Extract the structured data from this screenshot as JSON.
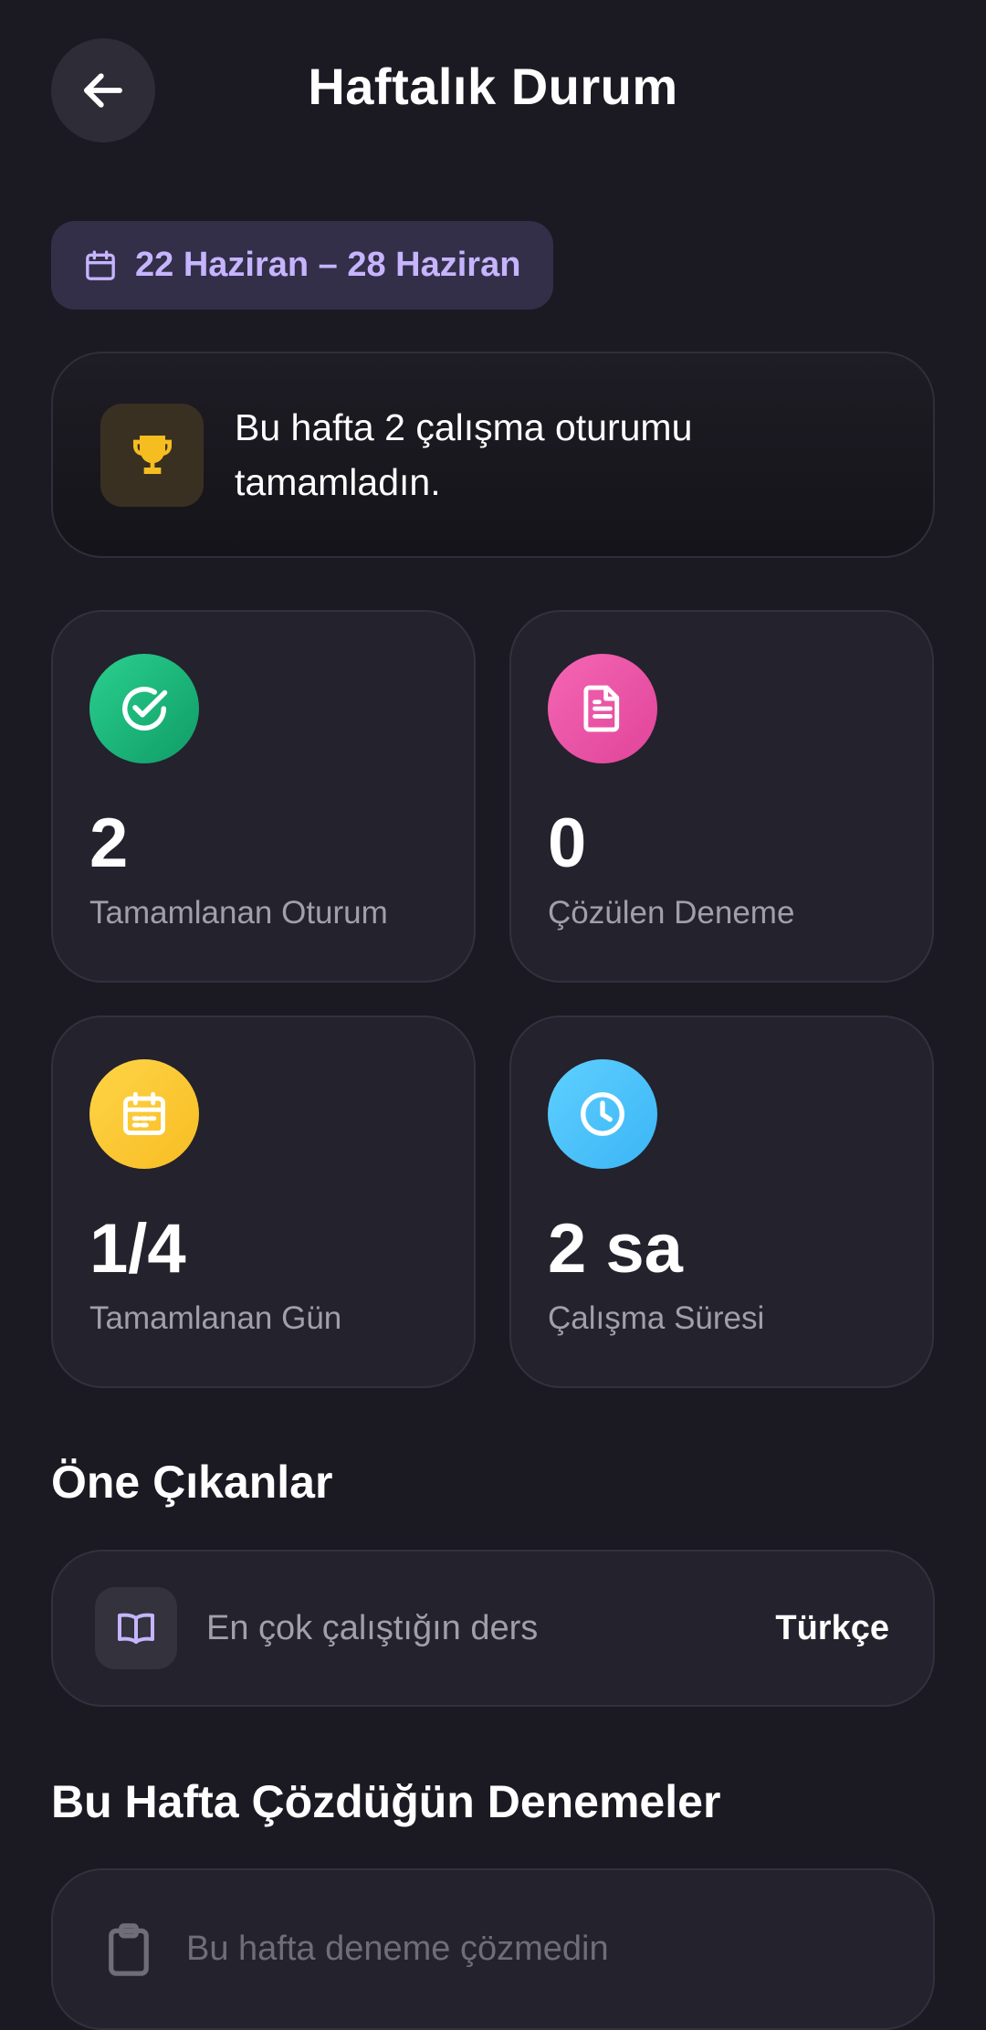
{
  "header": {
    "title": "Haftalık Durum"
  },
  "date_range": {
    "label": "22 Haziran – 28 Haziran"
  },
  "summary": {
    "text": "Bu hafta 2 çalışma oturumu tamamladın."
  },
  "stats": [
    {
      "value": "2",
      "label": "Tamamlanan Oturum",
      "icon": "check-circle-icon",
      "color": "#1fbf7f"
    },
    {
      "value": "0",
      "label": "Çözülen Deneme",
      "icon": "document-icon",
      "color": "#ee58a8"
    },
    {
      "value": "1/4",
      "label": "Tamamlanan Gün",
      "icon": "calendar-icon",
      "color": "#fcca35"
    },
    {
      "value": "2 sa",
      "label": "Çalışma Süresi",
      "icon": "clock-icon",
      "color": "#4cc4fb"
    }
  ],
  "highlights": {
    "title": "Öne Çıkanlar",
    "item": {
      "label": "En çok çalıştığın ders",
      "value": "Türkçe",
      "icon": "book-icon"
    }
  },
  "exams": {
    "title": "Bu Hafta Çözdüğün Denemeler",
    "empty_text": "Bu hafta deneme çözmedin",
    "icon": "clipboard-icon"
  },
  "colors": {
    "background": "#1b1922",
    "card": "#24222c",
    "accent_purple": "#c6b4ff",
    "trophy": "#f5bd1f"
  }
}
